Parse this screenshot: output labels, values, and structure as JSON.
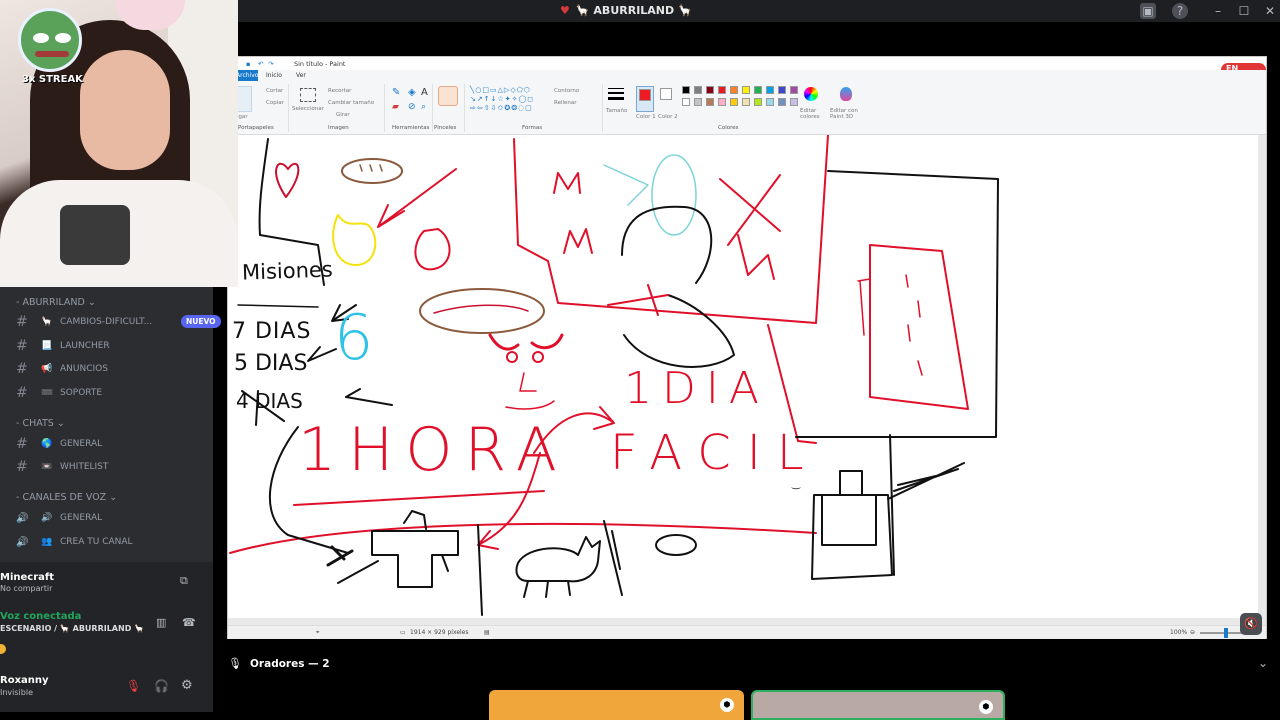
{
  "window": {
    "title": "ABURRILAND",
    "title_prefix": "🦙",
    "title_suffix": "🦙"
  },
  "webcam": {
    "streak": "3x STREAK"
  },
  "sidebar": {
    "server_category": "ABURRILAND",
    "channels_top": [
      {
        "emoji": "🦙",
        "name": "CAMBIOS-DIFICULT...",
        "badge": "NUEVO"
      },
      {
        "emoji": "📃",
        "name": "LAUNCHER"
      },
      {
        "emoji": "📢",
        "name": "ANUNCIOS"
      },
      {
        "emoji": "🎟",
        "name": "SOPORTE"
      }
    ],
    "chats_category": "CHATS",
    "chats": [
      {
        "emoji": "🌎",
        "name": "GENERAL"
      },
      {
        "emoji": "📼",
        "name": "WHITELIST"
      }
    ],
    "voice_category": "CANALES DE VOZ",
    "voice": [
      {
        "emoji": "🔊",
        "name": "GENERAL"
      },
      {
        "emoji": "👥",
        "name": "CREA TU CANAL"
      }
    ]
  },
  "userpanel": {
    "activity": "Minecraft",
    "activity_sub": "No compartir",
    "voice_status": "Voz conectada",
    "voice_channel": "ESCENARIO / 🦙 ABURRILAND 🦙",
    "username": "Roxanny",
    "user_status": "Invisible"
  },
  "paint": {
    "title": "Sin título - Paint",
    "tabs": [
      "Archivo",
      "Inicio",
      "Ver"
    ],
    "groups": [
      "Portapapeles",
      "Imagen",
      "Herramientas",
      "Pinceles",
      "Formas",
      "Colores"
    ],
    "labels": {
      "cut": "Cortar",
      "copy": "Copiar",
      "paste": "Pegar",
      "select": "Seleccionar",
      "crop": "Recortar",
      "resize": "Cambiar tamaño",
      "rotate": "Girar",
      "outline": "Contorno",
      "fill": "Rellenar",
      "size": "Tamaño",
      "color1": "Color 1",
      "color2": "Color 2",
      "edit_colors": "Editar colores",
      "paint3d": "Editar con Paint 3D"
    },
    "palette": [
      "#000000",
      "#7f7f7f",
      "#880015",
      "#ed1c24",
      "#ff7f27",
      "#fff200",
      "#22b14c",
      "#00a2e8",
      "#3f48cc",
      "#a349a4",
      "#ffffff",
      "#c3c3c3",
      "#b97a57",
      "#ffaec9",
      "#ffc90e",
      "#efe4b0",
      "#b5e61d",
      "#99d9ea",
      "#7092be",
      "#c8bfe7"
    ],
    "color1": "#ed1c24",
    "status_size": "1914 × 929 píxeles",
    "zoom": "100%",
    "live_badge": "EN VIVO",
    "canvas_text": {
      "misiones": "Misiones",
      "dias7": "7 DIAS",
      "dias5": "5 DIAS",
      "dias4": "4 DIAS",
      "six": "6",
      "hora": "1HORA",
      "dia": "1DIA",
      "facil": "FACIL"
    }
  },
  "speakers": {
    "label": "Oradores — 2"
  },
  "colors": {
    "accent": "#5865f2",
    "paint_red": "#e0102a",
    "voice_green": "#23a55a",
    "live": "#e23636"
  }
}
